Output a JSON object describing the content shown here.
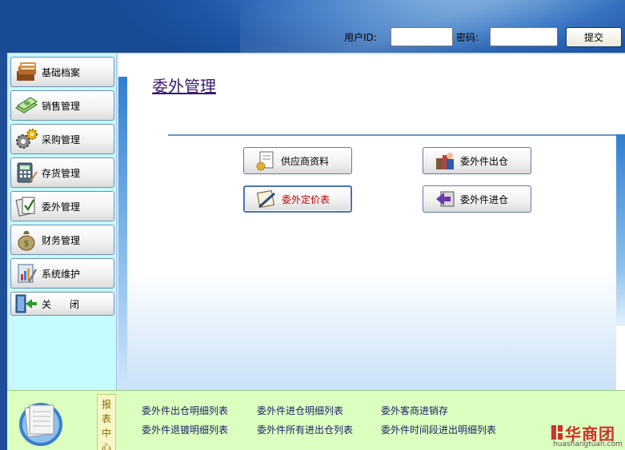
{
  "login": {
    "userid_label": "用户ID:",
    "userid_value": "",
    "password_label": "密码:",
    "password_value": "",
    "submit_label": "提交"
  },
  "sidebar": {
    "items": [
      {
        "label": "基础档案",
        "icon": "archive-boxes-icon"
      },
      {
        "label": "销售管理",
        "icon": "banknote-icon"
      },
      {
        "label": "采购管理",
        "icon": "gears-icon"
      },
      {
        "label": "存货管理",
        "icon": "calculator-icon"
      },
      {
        "label": "委外管理",
        "icon": "documents-check-icon"
      },
      {
        "label": "财务管理",
        "icon": "money-bag-icon"
      },
      {
        "label": "系统维护",
        "icon": "tools-icon"
      },
      {
        "label": "关      闭",
        "icon": "exit-door-icon"
      }
    ]
  },
  "main": {
    "title": "委外管理",
    "actions": [
      {
        "label": "供应商资料",
        "icon": "supplier-doc-icon"
      },
      {
        "label": "委外件出仓",
        "icon": "warehouse-out-icon"
      },
      {
        "label": "委外定价表",
        "icon": "pricing-doc-icon",
        "active": true
      },
      {
        "label": "委外件进仓",
        "icon": "warehouse-in-icon"
      }
    ]
  },
  "report_center": {
    "tab_chars": [
      "报",
      "表",
      "中",
      "心"
    ],
    "links": [
      "委外件出仓明细列表",
      "委外件进仓明细列表",
      "委外客商进销存",
      "委外件退镀明细列表",
      "委外件所有进出仓列表",
      "委外件时间段进出明细列表"
    ]
  },
  "watermark": {
    "text": "华商团",
    "url": "huashangtuan.com"
  },
  "colors": {
    "header_blue": "#1f56a6",
    "sidebar_bg": "#c5fbff",
    "report_bg": "#dcffbf",
    "title_color": "#3b1a6e",
    "active_label": "#c00000"
  }
}
